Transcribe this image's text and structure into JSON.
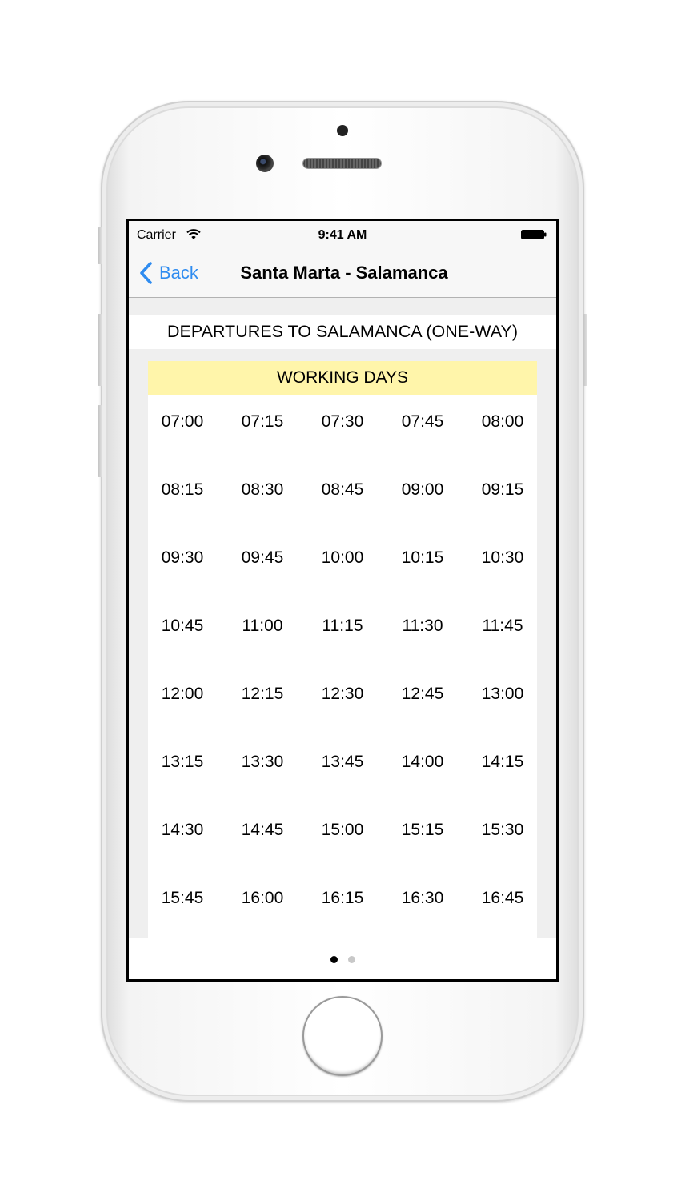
{
  "status_bar": {
    "carrier": "Carrier",
    "time": "9:41 AM"
  },
  "nav": {
    "back_label": "Back",
    "title": "Santa Marta - Salamanca"
  },
  "section": {
    "title": "DEPARTURES TO SALAMANCA (ONE-WAY)"
  },
  "timetable": {
    "day_type": "WORKING DAYS",
    "times": [
      "07:00",
      "07:15",
      "07:30",
      "07:45",
      "08:00",
      "08:15",
      "08:30",
      "08:45",
      "09:00",
      "09:15",
      "09:30",
      "09:45",
      "10:00",
      "10:15",
      "10:30",
      "10:45",
      "11:00",
      "11:15",
      "11:30",
      "11:45",
      "12:00",
      "12:15",
      "12:30",
      "12:45",
      "13:00",
      "13:15",
      "13:30",
      "13:45",
      "14:00",
      "14:15",
      "14:30",
      "14:45",
      "15:00",
      "15:15",
      "15:30",
      "15:45",
      "16:00",
      "16:15",
      "16:30",
      "16:45"
    ]
  },
  "pager": {
    "page_count": 2,
    "active_page": 1
  },
  "colors": {
    "accent": "#2f8cf0",
    "day_header_bg": "#fff5aa",
    "screen_bg": "#efefef"
  },
  "icons": {
    "wifi": "wifi-icon",
    "battery": "battery-icon",
    "back": "chevron-left-icon"
  }
}
